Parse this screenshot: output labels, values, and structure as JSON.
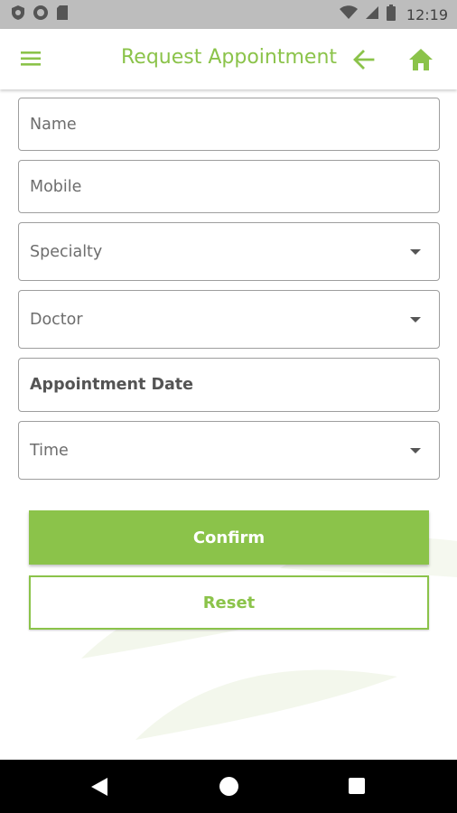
{
  "status_bar": {
    "time": "12:19"
  },
  "app_bar": {
    "title": "Request Appointment"
  },
  "form": {
    "name": {
      "label": "Name"
    },
    "mobile": {
      "label": "Mobile"
    },
    "specialty": {
      "label": "Specialty"
    },
    "doctor": {
      "label": "Doctor"
    },
    "appointment_date": {
      "label": "Appointment Date"
    },
    "time": {
      "label": "Time"
    }
  },
  "buttons": {
    "confirm": "Confirm",
    "reset": "Reset"
  },
  "icons": {
    "menu": "hamburger-menu-icon",
    "back": "arrow-left-icon",
    "home": "home-icon",
    "nav_back": "triangle-back-icon",
    "nav_home": "circle-home-icon",
    "nav_recents": "square-recents-icon"
  },
  "colors": {
    "accent": "#8bc34a",
    "status_bar": "#bdbdbd",
    "nav_bar": "#000000"
  }
}
